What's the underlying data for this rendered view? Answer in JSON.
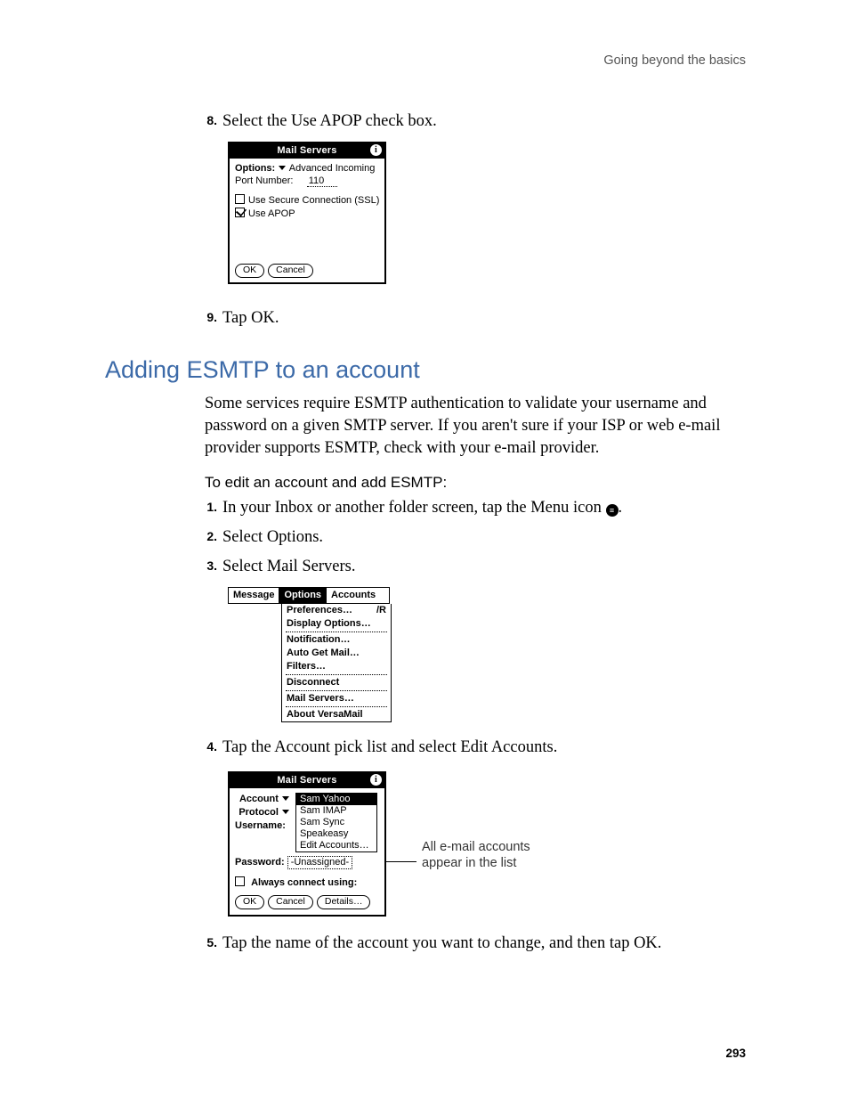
{
  "running_head": "Going beyond the basics",
  "page_number": "293",
  "steps_a": {
    "s8": {
      "n": "8.",
      "t": "Select the Use APOP check box."
    },
    "s9": {
      "n": "9.",
      "t": "Tap OK."
    }
  },
  "dialog1": {
    "title": "Mail Servers",
    "options_label": "Options:",
    "options_value": "Advanced Incoming",
    "port_label": "Port Number:",
    "port_value": "110",
    "ssl": "Use Secure Connection (SSL)",
    "apop": "Use APOP",
    "ok": "OK",
    "cancel": "Cancel"
  },
  "h2": "Adding ESMTP to an account",
  "intro": "Some services require ESMTP authentication to validate your username and password on a given SMTP server. If you aren't sure if your ISP or web e-mail provider supports ESMTP, check with your e-mail provider.",
  "h3": "To edit an account and add ESMTP:",
  "steps_b": {
    "s1": {
      "n": "1.",
      "pre": "In your Inbox or another folder screen, tap the Menu icon ",
      "post": "."
    },
    "s2": {
      "n": "2.",
      "t": "Select Options."
    },
    "s3": {
      "n": "3.",
      "t": "Select Mail Servers."
    },
    "s4": {
      "n": "4.",
      "t": "Tap the Account pick list and select Edit Accounts."
    },
    "s5": {
      "n": "5.",
      "t": "Tap the name of the account you want to change, and then tap OK."
    }
  },
  "menubar": {
    "tab1": "Message",
    "tab2": "Options",
    "tab3": "Accounts"
  },
  "menu": {
    "prefs": "Preferences…",
    "prefs_sc": "/R",
    "display": "Display Options…",
    "notif": "Notification…",
    "autoget": "Auto Get Mail…",
    "filters": "Filters…",
    "disconnect": "Disconnect",
    "mailservers": "Mail Servers…",
    "about": "About VersaMail"
  },
  "dialog2": {
    "title": "Mail Servers",
    "account_label": "Account",
    "protocol_label": "Protocol",
    "username_label": "Username:",
    "password_label": "Password:",
    "password_value": "-Unassigned-",
    "always_connect": "Always connect using:",
    "ok": "OK",
    "cancel": "Cancel",
    "details": "Details…",
    "picklist": [
      "Sam Yahoo",
      "Sam IMAP",
      "Sam Sync",
      "Speakeasy",
      "Edit Accounts…"
    ]
  },
  "annotation": {
    "line1": "All e-mail accounts",
    "line2": "appear in the list"
  }
}
